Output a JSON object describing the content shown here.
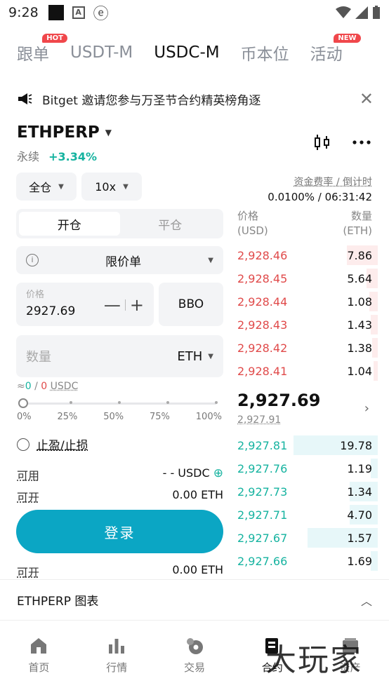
{
  "status": {
    "time": "9:28",
    "a_icon": "A"
  },
  "tabs": [
    {
      "label": "跟单",
      "badge": "HOT"
    },
    {
      "label": "USDT-M"
    },
    {
      "label": "USDC-M"
    },
    {
      "label": "币本位"
    },
    {
      "label": "活动",
      "badge": "NEW"
    }
  ],
  "notice": {
    "text": "Bitget 邀请您参与万圣节合约精英榜角逐",
    "close": "✕"
  },
  "symbol": {
    "name": "ETHPERP",
    "type": "永续",
    "change": "+3.34%"
  },
  "margin_mode": "全仓",
  "leverage": "10x",
  "funding": {
    "title": "资金费率 / 倒计时",
    "value": "0.0100% / 06:31:42"
  },
  "position_tabs": {
    "open": "开仓",
    "close": "平仓"
  },
  "order_type": "限价单",
  "price": {
    "label": "价格",
    "value": "2927.69",
    "minus": "—",
    "plus": "+",
    "bbo": "BBO"
  },
  "quantity": {
    "placeholder": "数量",
    "unit": "ETH"
  },
  "approx": {
    "prefix": "≈",
    "value": "0",
    "sep": " / ",
    "value2": "0",
    "unit": "USDC"
  },
  "slider_ticks": [
    "0%",
    "25%",
    "50%",
    "75%",
    "100%"
  ],
  "tpsl": "止盈/止损",
  "available": {
    "label": "可用",
    "value": "- - USDC"
  },
  "can_open_1": {
    "label": "可开",
    "value": "0.00 ETH"
  },
  "login": "登录",
  "can_open_2": {
    "label": "可开",
    "value": "0.00 ETH"
  },
  "orderbook": {
    "header": {
      "price": "价格",
      "price_unit": "(USD)",
      "qty": "数量",
      "qty_unit": "(ETH)"
    },
    "asks": [
      {
        "price": "2,928.46",
        "qty": "7.86",
        "depth": 0.22
      },
      {
        "price": "2,928.45",
        "qty": "5.64",
        "depth": 0.08
      },
      {
        "price": "2,928.44",
        "qty": "1.08",
        "depth": 0.06
      },
      {
        "price": "2,928.43",
        "qty": "1.43",
        "depth": 0.05
      },
      {
        "price": "2,928.42",
        "qty": "1.38",
        "depth": 0.04
      },
      {
        "price": "2,928.41",
        "qty": "1.04",
        "depth": 0.03
      }
    ],
    "last_price": "2,927.69",
    "mark_price": "2,927.91",
    "bids": [
      {
        "price": "2,927.81",
        "qty": "19.78",
        "depth": 0.6
      },
      {
        "price": "2,927.76",
        "qty": "1.19",
        "depth": 0.05
      },
      {
        "price": "2,927.73",
        "qty": "1.34",
        "depth": 0.2
      },
      {
        "price": "2,927.71",
        "qty": "4.70",
        "depth": 0.2
      },
      {
        "price": "2,927.67",
        "qty": "1.57",
        "depth": 0.5
      },
      {
        "price": "2,927.66",
        "qty": "1.69",
        "depth": 0.05
      }
    ]
  },
  "chart_toggle": "ETHPERP 图表",
  "nav": [
    {
      "label": "首页",
      "icon": "home-icon"
    },
    {
      "label": "行情",
      "icon": "chart-bars-icon"
    },
    {
      "label": "交易",
      "icon": "trade-icon"
    },
    {
      "label": "合约",
      "icon": "futures-icon",
      "active": true
    },
    {
      "label": "资产",
      "icon": "wallet-icon"
    }
  ],
  "watermark": "大玩家",
  "colors": {
    "accent": "#0ba6c4",
    "green": "#16b3a0",
    "red": "#e04a4a"
  }
}
